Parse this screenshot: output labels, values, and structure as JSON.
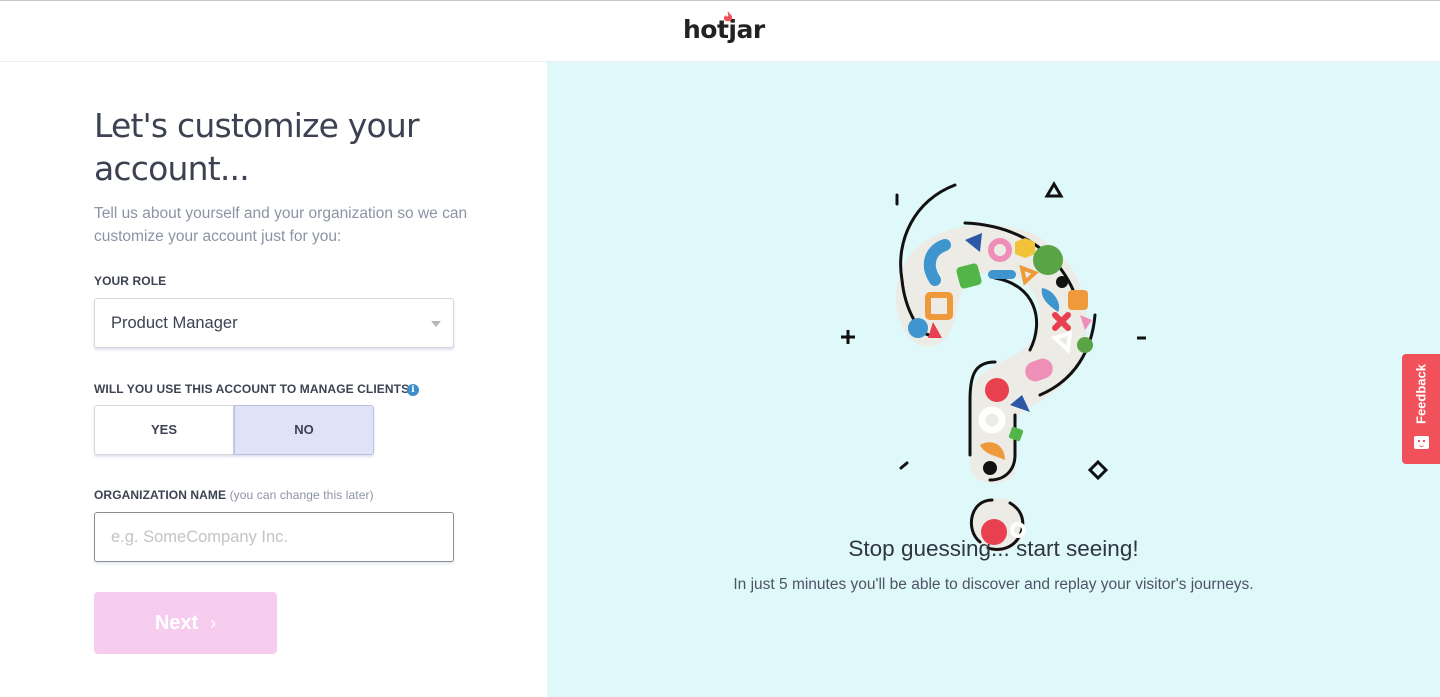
{
  "header": {
    "logo": "hotjar",
    "brand_color": "#f0515a"
  },
  "form": {
    "title": "Let's customize your account...",
    "subtitle": "Tell us about yourself and your organization so we can customize your account just for you:",
    "role": {
      "label": "YOUR ROLE",
      "selected": "Product Manager"
    },
    "clients": {
      "label": "WILL YOU USE THIS ACCOUNT TO MANAGE CLIENTS?",
      "yes_label": "YES",
      "no_label": "NO",
      "selected": "NO"
    },
    "org": {
      "label": "ORGANIZATION NAME",
      "hint": "(you can change this later)",
      "value": "",
      "placeholder": "e.g. SomeCompany Inc."
    },
    "next_label": "Next",
    "next_icon": "chevron-right-icon"
  },
  "promo": {
    "headline": "Stop guessing... start seeing!",
    "subline": "In just 5 minutes you'll be able to discover and replay your visitor's journeys."
  },
  "feedback": {
    "label": "Feedback",
    "icon": "smiley-face-icon"
  }
}
